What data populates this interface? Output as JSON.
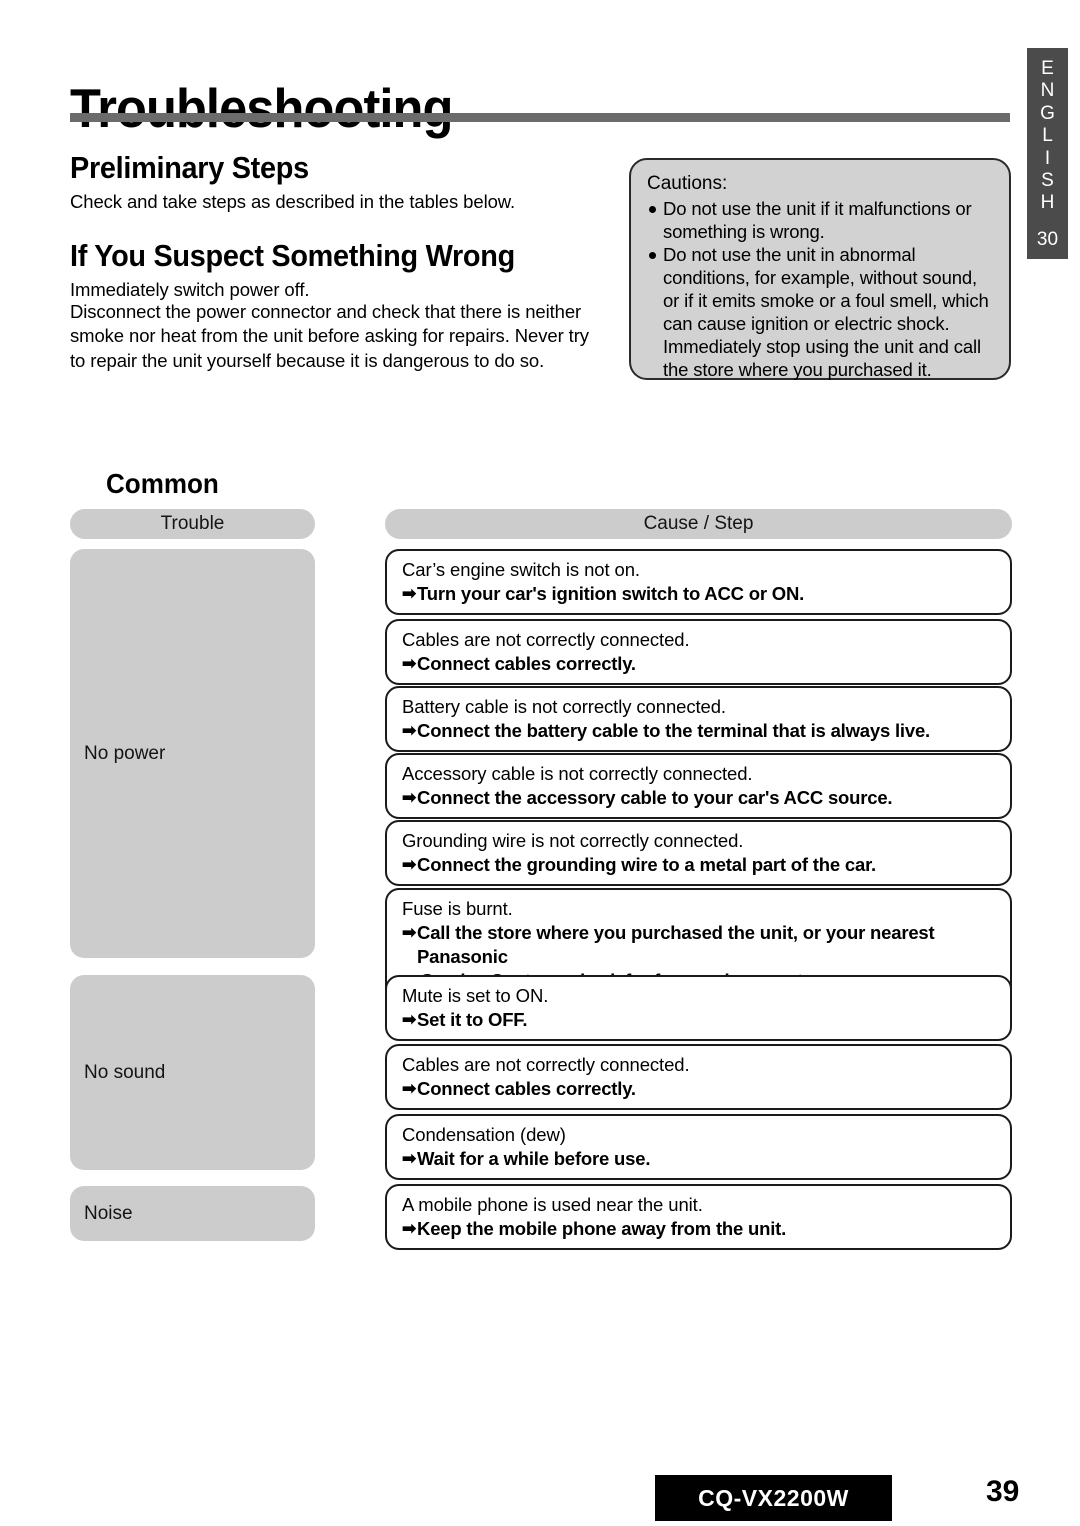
{
  "language_tab": {
    "letters": [
      "E",
      "N",
      "G",
      "L",
      "I",
      "S",
      "H"
    ],
    "number": "30"
  },
  "page_title": "Troubleshooting",
  "sections": {
    "preliminary": {
      "heading": "Preliminary Steps",
      "body": "Check and take steps as described in the tables below."
    },
    "suspect": {
      "heading": "If You Suspect Something Wrong",
      "line1": "Immediately switch power off.",
      "body": "Disconnect the power connector and check that there is neither smoke nor heat from the unit before asking for repairs. Never try to repair the unit yourself because it is dangerous to do so."
    }
  },
  "cautions": {
    "title": "Cautions:",
    "items": [
      "Do not use the unit if it malfunctions or something is wrong.",
      "Do not use the unit in abnormal conditions, for example, without sound, or if it emits smoke or a foul smell, which can cause ignition or electric shock. Immediately stop using the unit and call the store where you purchased it."
    ]
  },
  "common": {
    "heading": "Common",
    "columns": {
      "trouble": "Trouble",
      "cause_step": "Cause / Step"
    },
    "groups": [
      {
        "label": "No power"
      },
      {
        "label": "No sound"
      },
      {
        "label": "Noise"
      }
    ],
    "rows": [
      {
        "cause": "Car’s engine switch is not on.",
        "step": "Turn your car's ignition switch to ACC or ON.",
        "step_cont": ""
      },
      {
        "cause": "Cables are not correctly connected.",
        "step": "Connect cables correctly.",
        "step_cont": ""
      },
      {
        "cause": "Battery cable is not correctly connected.",
        "step": "Connect the battery cable to the terminal that is always live.",
        "step_cont": ""
      },
      {
        "cause": "Accessory cable is not correctly connected.",
        "step": "Connect the accessory cable to your car's ACC source.",
        "step_cont": ""
      },
      {
        "cause": "Grounding wire is not correctly connected.",
        "step": "Connect the grounding wire to a metal part of the car.",
        "step_cont": ""
      },
      {
        "cause": "Fuse is burnt.",
        "step": "Call the store where you purchased the unit, or your nearest Panasonic",
        "step_cont": "Service Center and ask for fuse replacement."
      },
      {
        "cause": "Mute is set to ON.",
        "step": "Set it to OFF.",
        "step_cont": ""
      },
      {
        "cause": "Cables are not correctly connected.",
        "step": "Connect cables correctly.",
        "step_cont": ""
      },
      {
        "cause": "Condensation (dew)",
        "step": "Wait for a while before use.",
        "step_cont": ""
      },
      {
        "cause": "A mobile phone is used near the unit.",
        "step": "Keep the mobile phone away from the unit.",
        "step_cont": ""
      }
    ],
    "arrow_icon": "➡"
  },
  "footer": {
    "model": "CQ-VX2200W",
    "page_number": "39"
  }
}
